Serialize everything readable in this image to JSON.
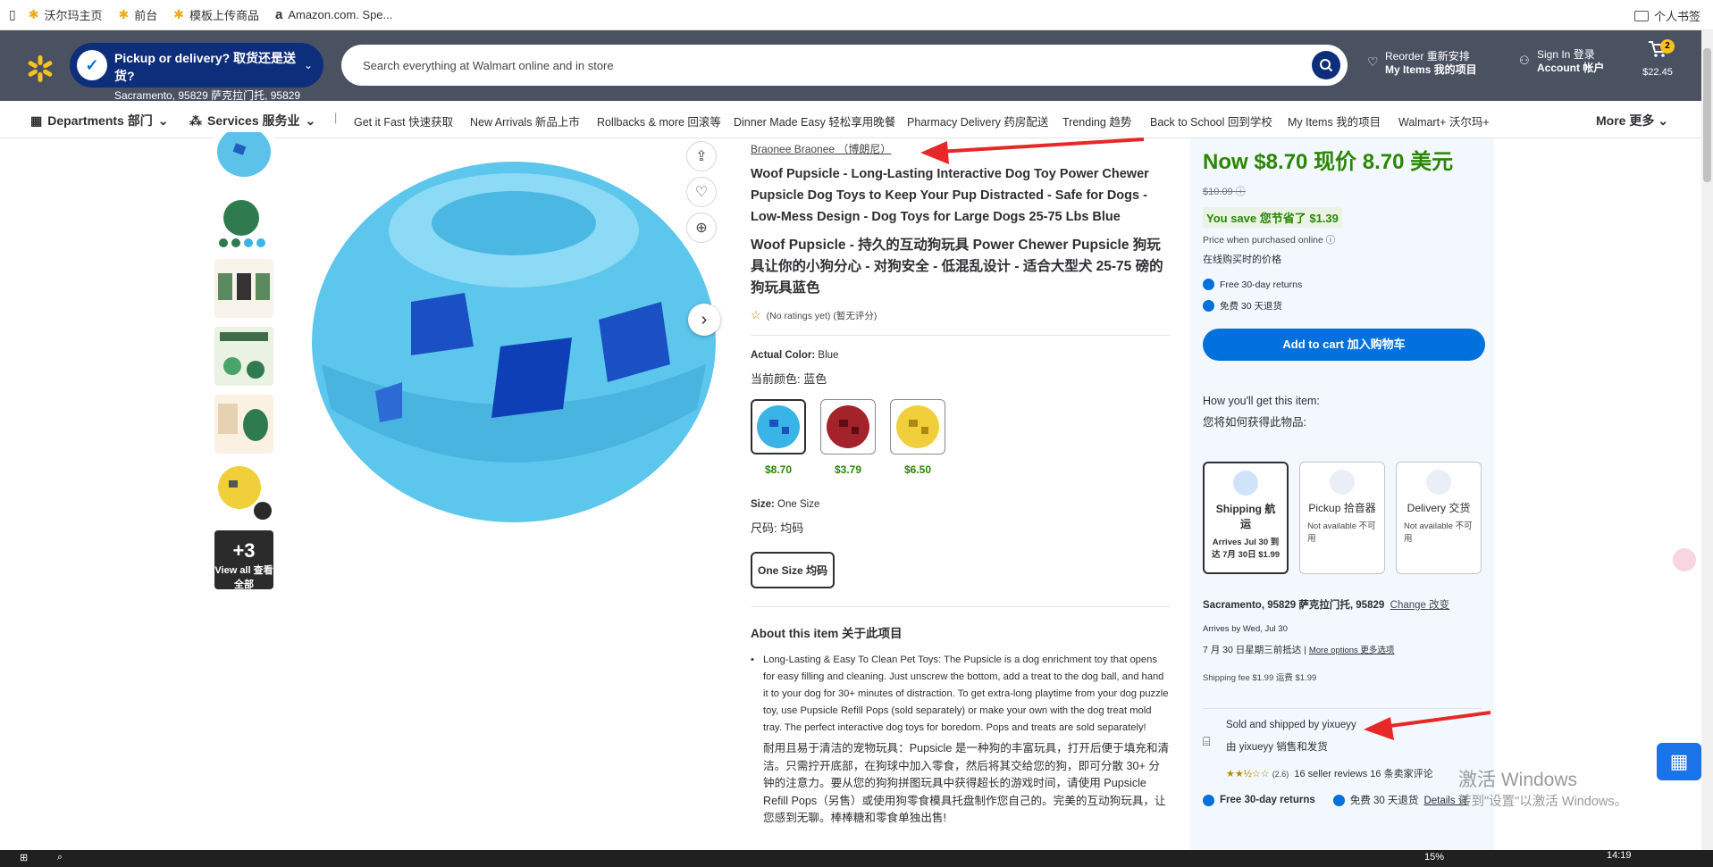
{
  "bookmarks": {
    "items": [
      {
        "label": "沃尔玛主页"
      },
      {
        "label": "前台"
      },
      {
        "label": "模板上传商品"
      },
      {
        "label": "Amazon.com. Spe..."
      }
    ],
    "right_label": "个人书签"
  },
  "header": {
    "pickup_title": "Pickup or delivery? 取货还是送货?",
    "pickup_location": "Sacramento, 95829 萨克拉门托, 95829",
    "search_placeholder": "Search everything at Walmart online and in store",
    "reorder_line1": "Reorder 重新安排",
    "reorder_line2": "My Items 我的项目",
    "signin_line1": "Sign In 登录",
    "signin_line2": "Account 帐户",
    "cart_count": "2",
    "cart_total": "$22.45"
  },
  "nav": {
    "departments": "Departments 部门",
    "services": "Services 服务业",
    "links": [
      "Get it Fast 快速获取",
      "New Arrivals 新品上市",
      "Rollbacks & more 回滚等",
      "Dinner Made Easy 轻松享用晚餐",
      "Pharmacy Delivery 药房配送",
      "Trending 趋势",
      "Back to School 回到学校",
      "My Items 我的项目",
      "Walmart+ 沃尔玛+"
    ],
    "more": "More 更多"
  },
  "gallery": {
    "view_all_count": "+3",
    "view_all_label": "View all 查看全部"
  },
  "product": {
    "brand": "Braonee Braonee （博朗尼）",
    "title_en": "Woof Pupsicle - Long-Lasting Interactive Dog Toy Power Chewer Pupsicle Dog Toys to Keep Your Pup Distracted - Safe for Dogs - Low-Mess Design - Dog Toys for Large Dogs 25-75 Lbs Blue",
    "title_cn": "Woof Pupsicle - 持久的互动狗玩具 Power Chewer Pupsicle 狗玩具让你的小狗分心 - 对狗安全 - 低混乱设计 - 适合大型犬 25-75 磅的狗玩具蓝色",
    "rating_text": "(No ratings yet)   (暂无评分)",
    "actual_color_label": "Actual Color:",
    "actual_color_value": "Blue",
    "color_cn": "当前颜色:   蓝色",
    "swatches": [
      {
        "price": "$8.70",
        "color": "#3ab4e6"
      },
      {
        "price": "$3.79",
        "color": "#a4222a"
      },
      {
        "price": "$6.50",
        "color": "#f1cf3a"
      }
    ],
    "size_label": "Size:",
    "size_value": "One Size",
    "size_cn": "尺码:   均码",
    "size_button": "One Size 均码",
    "about_title": "About this item 关于此项目",
    "about_bullet_en": "Long-Lasting & Easy To Clean Pet Toys: The Pupsicle is a dog enrichment toy that opens for easy filling and cleaning. Just unscrew the bottom, add a treat to the dog ball, and hand it to your dog for 30+ minutes of distraction. To get extra-long playtime from your dog puzzle toy, use Pupsicle Refill Pops (sold separately) or make your own with the dog treat mold tray. The perfect interactive dog toys for boredom. Pops and treats are sold separately!",
    "about_bullet_cn": "耐用且易于清洁的宠物玩具：Pupsicle 是一种狗的丰富玩具，打开后便于填充和清洁。只需拧开底部，在狗球中加入零食，然后将其交给您的狗，即可分散 30+ 分钟的注意力。要从您的狗狗拼图玩具中获得超长的游戏时间，请使用 Pupsicle Refill Pops（另售）或使用狗零食模具托盘制作您自己的。完美的互动狗玩具，让您感到无聊。棒棒糖和零食单独出售!"
  },
  "buybox": {
    "now_price": "Now $8.70 现价 8.70 美元",
    "was_price": "$10.09",
    "you_save": "You save 您节省了 $1.39",
    "price_online": "Price when purchased online",
    "price_online_cn": "在线购买时的价格",
    "free_returns": "Free 30-day returns",
    "free_returns_cn": "免费 30 天退货",
    "add_to_cart": "Add to cart 加入购物车",
    "how_get": "How you'll get this item:",
    "how_get_cn": "您将如何获得此物品:",
    "options": [
      {
        "title": "Shipping 航运",
        "sub": "Arrives Jul 30 到达 7月 30日 $1.99"
      },
      {
        "title": "Pickup 拾音器",
        "sub": "Not available 不可用"
      },
      {
        "title": "Delivery 交货",
        "sub": "Not available 不可用"
      }
    ],
    "location": "Sacramento, 95829 萨克拉门托, 95829",
    "change": "Change 改变",
    "arrives_by": "Arrives by Wed, Jul 30",
    "arrives_cn": "7 月 30 日星期三前抵达",
    "more_options": "More options 更多选项",
    "shipping_fee": "Shipping fee $1.99 运费 $1.99",
    "sold_by": "Sold and shipped by yixueyy",
    "sold_by_cn": "由 yixueyy 销售和发货",
    "seller_rating": "(2.6)",
    "seller_reviews": "16 seller reviews 16 条卖家评论",
    "free_returns2": "Free 30-day returns",
    "free_returns2_cn": "免费 30 天退货",
    "details": "Details 详"
  },
  "watermark": {
    "line1": "激活 Windows",
    "line2": "转到\"设置\"以激活 Windows。"
  },
  "taskbar": {
    "percent": "15%",
    "time": "14:19"
  }
}
